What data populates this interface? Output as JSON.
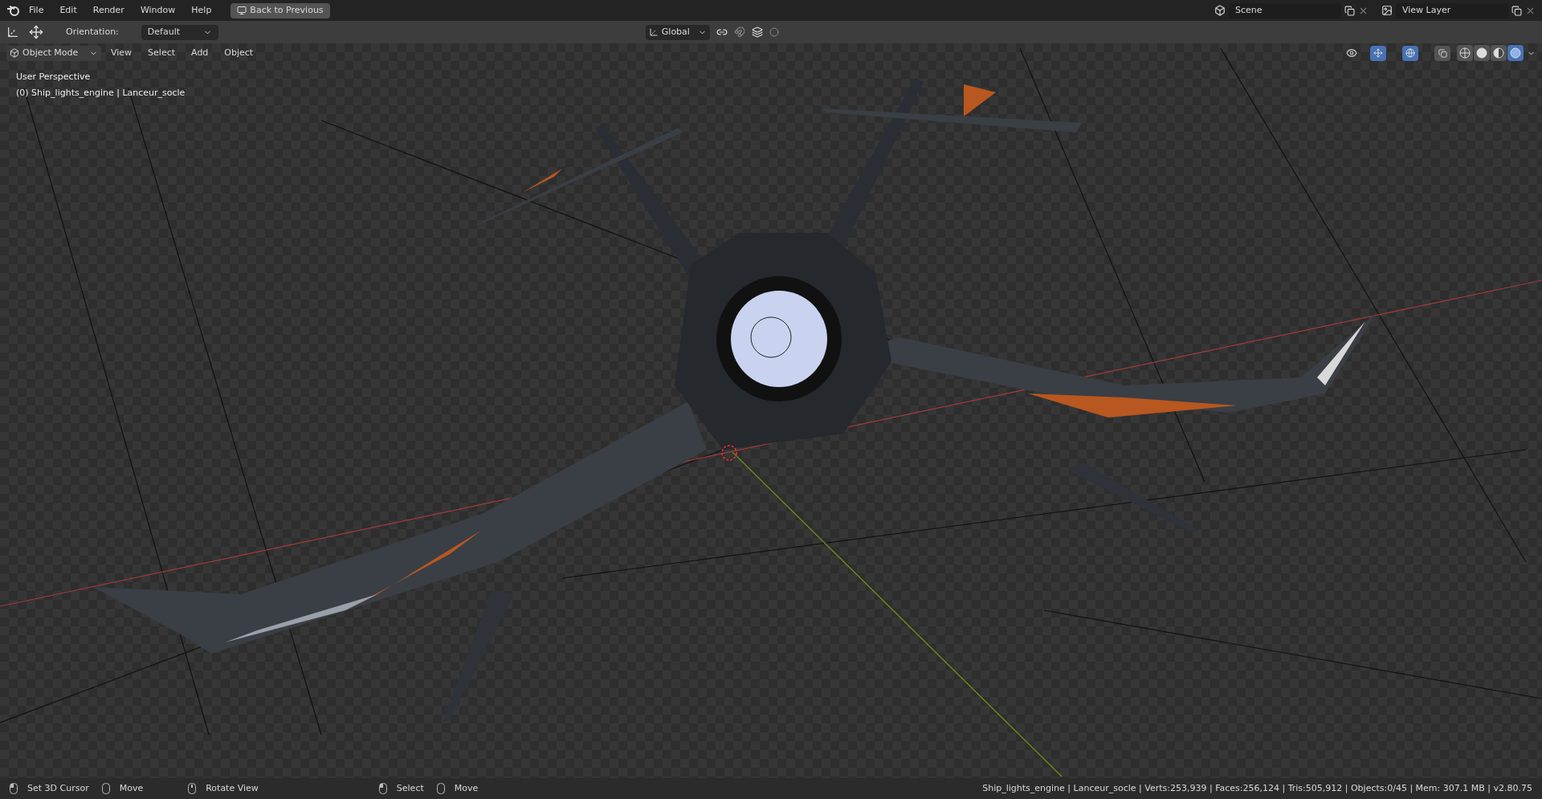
{
  "topbar": {
    "menus": [
      "File",
      "Edit",
      "Render",
      "Window",
      "Help"
    ],
    "back_button": "Back to Previous",
    "scene": "Scene",
    "view_layer": "View Layer"
  },
  "tool_header": {
    "orientation_label": "Orientation:",
    "orientation_value": "Default",
    "transform_orientation": "Global"
  },
  "viewport_header": {
    "mode": "Object Mode",
    "menus": [
      "View",
      "Select",
      "Add",
      "Object"
    ],
    "shading": [
      {
        "kind": "wireframe",
        "selected": false
      },
      {
        "kind": "solid",
        "selected": false
      },
      {
        "kind": "material",
        "selected": false
      },
      {
        "kind": "rendered",
        "selected": true
      }
    ]
  },
  "viewport": {
    "view_name": "User Perspective",
    "object_info": "(0) Ship_lights_engine | Lanceur_socle"
  },
  "status_bar": {
    "hints": [
      {
        "kind": "left",
        "label": "Set 3D Cursor"
      },
      {
        "kind": "drag",
        "label": "Move"
      },
      {
        "kind": "middle",
        "label": "Rotate View"
      },
      {
        "kind": "left",
        "label": "Select"
      },
      {
        "kind": "drag",
        "label": "Move"
      }
    ],
    "stats": "Ship_lights_engine | Lanceur_socle | Verts:253,939 | Faces:256,124 | Tris:505,912 | Objects:0/45 | Mem: 307.1 MB | v2.80.75"
  }
}
